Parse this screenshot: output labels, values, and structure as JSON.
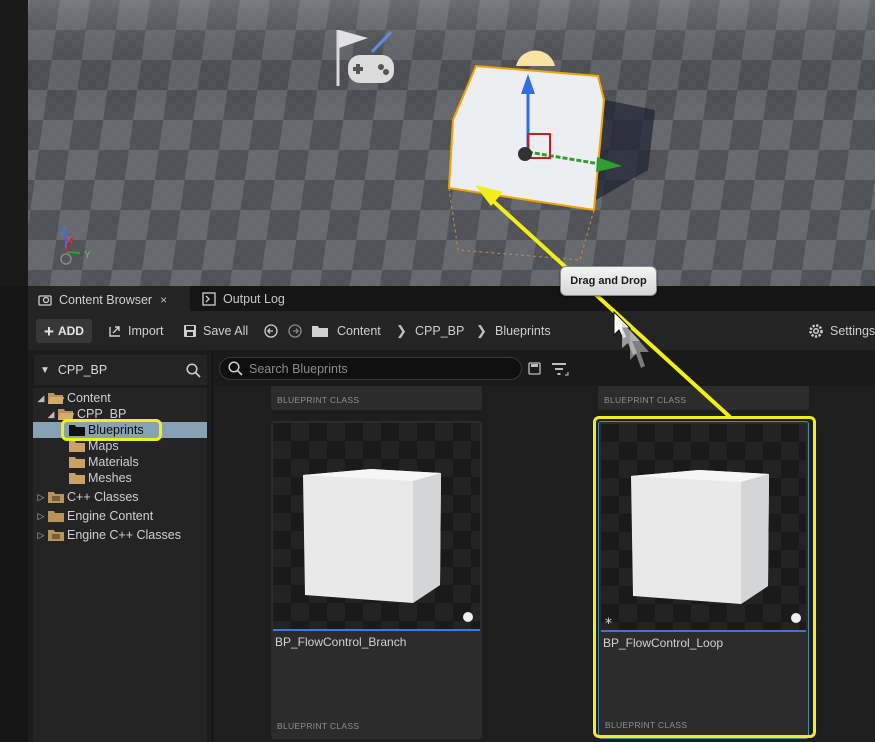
{
  "tabs": [
    {
      "label": "Content Browser",
      "close": "×"
    },
    {
      "label": "Output Log"
    }
  ],
  "toolbar": {
    "add_label": "ADD",
    "import_label": "Import",
    "save_all_label": "Save All",
    "breadcrumb": [
      "Content",
      "CPP_BP",
      "Blueprints"
    ],
    "settings_label": "Settings"
  },
  "sidebar": {
    "header": "CPP_BP",
    "tree": [
      {
        "label": "Content",
        "expanded": true
      },
      {
        "label": "CPP_BP",
        "expanded": true
      },
      {
        "label": "Blueprints",
        "selected": true
      },
      {
        "label": "Maps"
      },
      {
        "label": "Materials"
      },
      {
        "label": "Meshes"
      },
      {
        "label": "C++ Classes",
        "expanded": false
      },
      {
        "label": "Engine Content",
        "expanded": false
      },
      {
        "label": "Engine C++ Classes",
        "expanded": false
      }
    ]
  },
  "search": {
    "placeholder": "Search Blueprints"
  },
  "assets": [
    {
      "name": "BP_FlowControl_Branch",
      "class": "BLUEPRINT CLASS"
    },
    {
      "name": "BP_FlowControl_Loop",
      "class": "BLUEPRINT CLASS"
    }
  ],
  "partial_assets": [
    {
      "class": "BLUEPRINT CLASS"
    },
    {
      "class": "BLUEPRINT CLASS"
    }
  ],
  "viewport": {
    "axis_labels": {
      "z": "Z",
      "x": "X",
      "y": "Y"
    }
  },
  "tooltip": "Drag and Drop",
  "colors": {
    "highlight": "#f2ee1a",
    "selection": "#87a1b5",
    "accent_blue": "#3f74d8",
    "panel": "#242424"
  }
}
